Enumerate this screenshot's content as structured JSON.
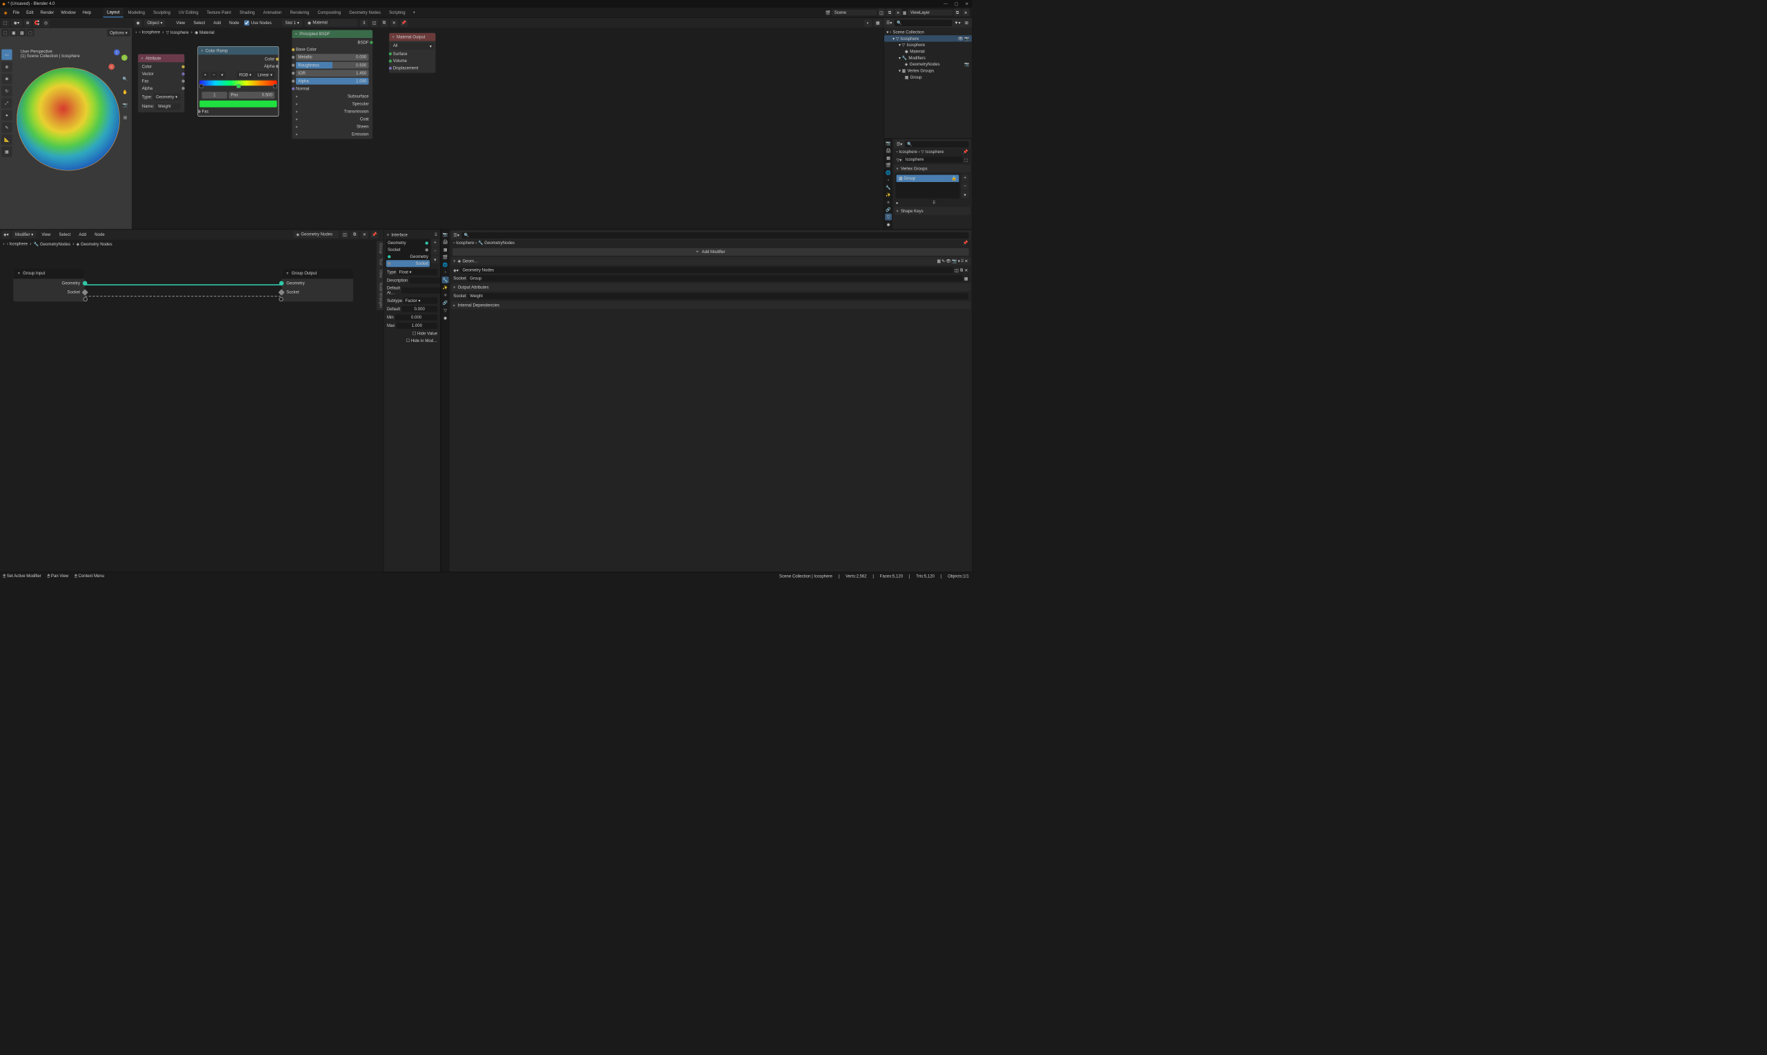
{
  "titlebar": {
    "title": "* (Unsaved) - Blender 4.0"
  },
  "menus": [
    "File",
    "Edit",
    "Render",
    "Window",
    "Help"
  ],
  "workspaces": [
    "Layout",
    "Modeling",
    "Sculpting",
    "UV Editing",
    "Texture Paint",
    "Shading",
    "Animation",
    "Rendering",
    "Compositing",
    "Geometry Nodes",
    "Scripting"
  ],
  "workspace_active": 0,
  "scene_name": "Scene",
  "viewlayer_name": "ViewLayer",
  "viewport": {
    "perspective": "User Perspective",
    "context": "(1) Scene Collection | Icosphere",
    "options_label": "Options"
  },
  "shader_hdr": {
    "view": "View",
    "select": "Select",
    "add": "Add",
    "node": "Node",
    "use_nodes": "Use Nodes",
    "slot": "Slot 1",
    "material": "Material",
    "object_mode": "Object",
    "count": "3"
  },
  "shader_breadcrumb": [
    "Icosphere",
    "Icosphere",
    "Material"
  ],
  "attr_node": {
    "title": "Attribute",
    "outputs": [
      "Color",
      "Vector",
      "Fac",
      "Alpha"
    ],
    "type_lbl": "Type:",
    "type_val": "Geometry",
    "name_lbl": "Name:",
    "name_val": "Weight"
  },
  "ramp_node": {
    "title": "Color Ramp",
    "outputs": [
      "Color",
      "Alpha"
    ],
    "mode": "RGB",
    "interp": "Linear",
    "idx": "1",
    "pos_lbl": "Pos",
    "pos_val": "0.500",
    "fac": "Fac"
  },
  "bsdf_node": {
    "title": "Principled BSDF",
    "bsdf_out": "BSDF",
    "base_color": "Base Color",
    "metallic": {
      "lbl": "Metallic",
      "val": "0.000"
    },
    "roughness": {
      "lbl": "Roughness",
      "val": "0.500"
    },
    "ior": {
      "lbl": "IOR",
      "val": "1.450"
    },
    "alpha": {
      "lbl": "Alpha",
      "val": "1.000"
    },
    "normal": "Normal",
    "groups": [
      "Subsurface",
      "Specular",
      "Transmission",
      "Coat",
      "Sheen",
      "Emission"
    ]
  },
  "out_node": {
    "title": "Material Output",
    "all": "All",
    "inputs": [
      "Surface",
      "Volume",
      "Displacement"
    ]
  },
  "outliner": {
    "root": "Scene Collection",
    "obj": "Icosphere",
    "mesh": "Icosphere",
    "mat": "Material",
    "mods": "Modifiers",
    "gn": "GeometryNodes",
    "vg": "Vertex Groups",
    "grp": "Group"
  },
  "geonodes_hdr": {
    "modifier": "Modifier",
    "view": "View",
    "select": "Select",
    "add": "Add",
    "node": "Node",
    "name": "Geometry Nodes"
  },
  "gn_breadcrumb": [
    "Icosphere",
    "GeometryNodes",
    "Geometry Nodes"
  ],
  "gn_input": {
    "title": "Group Input",
    "geometry": "Geometry",
    "socket": "Socket"
  },
  "gn_output": {
    "title": "Group Output",
    "geometry": "Geometry",
    "socket": "Socket"
  },
  "gn_side": {
    "interface": "Interface",
    "items": [
      {
        "name": "Geometry",
        "color": "#30c8a8",
        "out": true
      },
      {
        "name": "Socket",
        "color": "#888",
        "out": true
      },
      {
        "name": "Geometry",
        "color": "#30c8a8"
      },
      {
        "name": "Socket",
        "color": "#888",
        "sel": true
      }
    ],
    "type_lbl": "Type",
    "type_val": "Float",
    "desc_lbl": "Description",
    "defattr_lbl": "Default At…",
    "subtype_lbl": "Subtype",
    "subtype_val": "Factor",
    "default_lbl": "Default",
    "default_val": "0.000",
    "min_lbl": "Min",
    "min_val": "0.000",
    "max_lbl": "Max",
    "max_val": "1.000",
    "hide_value": "Hide Value",
    "hide_mod": "Hide in Mod…"
  },
  "gn_tabs": [
    "Group",
    "Tool",
    "View",
    "Node Wrangler"
  ],
  "props_mesh": {
    "breadcrumb": [
      "Icosphere",
      "Icosphere"
    ],
    "name": "Icosphere",
    "vg_panel": "Vertex Groups",
    "vg_item": "Group",
    "sk_panel": "Shape Keys"
  },
  "props_mod": {
    "breadcrumb": [
      "Icosphere",
      "GeometryNodes"
    ],
    "add": "Add Modifier",
    "gn_name": "Geom…",
    "gn_full": "Geometry Nodes",
    "socket_lbl": "Socket",
    "socket_val": "Group",
    "out_attr_panel": "Output Attributes",
    "out_socket_lbl": "Socket",
    "out_socket_val": "Weight",
    "internal": "Internal Dependencies"
  },
  "status": {
    "left": [
      "Set Active Modifier",
      "Pan View",
      "Context Menu"
    ],
    "right_path": "Scene Collection | Icosphere",
    "stats": [
      "Verts:2,562",
      "Faces:5,120",
      "Tris:5,120",
      "Objects:1/1"
    ]
  }
}
